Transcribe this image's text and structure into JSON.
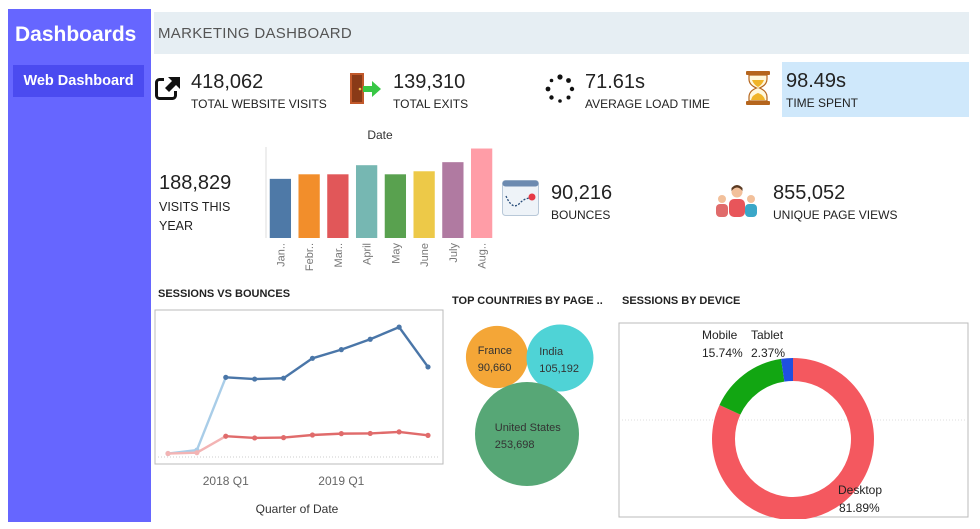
{
  "sidebar": {
    "brand": "Dashboards",
    "items": [
      {
        "label": "Web Dashboard"
      }
    ]
  },
  "header": {
    "title": "MARKETING DASHBOARD"
  },
  "kpis": {
    "visits": {
      "value": "418,062",
      "label": "TOTAL WEBSITE VISITS",
      "icon": "external-link-icon"
    },
    "exits": {
      "value": "139,310",
      "label": "TOTAL EXITS",
      "icon": "exit-door-icon"
    },
    "load": {
      "value": "71.61s",
      "label": "AVERAGE LOAD TIME",
      "icon": "loading-spinner-icon"
    },
    "time": {
      "value": "98.49s",
      "label": "TIME SPENT",
      "icon": "hourglass-icon"
    },
    "bounces": {
      "value": "90,216",
      "label": "BOUNCES",
      "icon": "bounce-chart-icon"
    },
    "unique": {
      "value": "855,052",
      "label": "UNIQUE PAGE VIEWS",
      "icon": "people-icon"
    }
  },
  "visits_year": {
    "value": "188,829",
    "label": "VISITS THIS YEAR"
  },
  "colors": {
    "sidebar": "#6666ff",
    "header": "#e6eef3",
    "highlight": "#cfe8fb",
    "desktop": "#f4585f",
    "mobile": "#12a612",
    "tablet": "#1f4fe0"
  },
  "sections": {
    "sessions_bounces": "SESSIONS VS BOUNCES",
    "top_countries": "TOP COUNTRIES BY PAGE ..",
    "sessions_device": "SESSIONS BY DEVICE"
  },
  "chart_data": [
    {
      "type": "bar",
      "title": "Date",
      "categories": [
        "Jan..",
        "Febr..",
        "Mar..",
        "April",
        "May",
        "June",
        "July",
        "Aug.."
      ],
      "values": [
        19500,
        21000,
        21000,
        24000,
        21000,
        22000,
        25000,
        29500
      ],
      "colors": [
        "#4e79a7",
        "#f28e2b",
        "#e15759",
        "#76b7b2",
        "#59a14f",
        "#edc948",
        "#b07aa1",
        "#ff9da7"
      ],
      "ylim": [
        0,
        30000
      ]
    },
    {
      "type": "line",
      "xlabel": "Quarter of Date",
      "x_tick_labels": [
        "2018 Q1",
        "2019 Q1"
      ],
      "series": [
        {
          "values": [
            0,
            2,
            44,
            43,
            43.5,
            55,
            60,
            66,
            73,
            50
          ],
          "color": "#4a76a8"
        },
        {
          "values": [
            0,
            0.5,
            10,
            9,
            9.2,
            10.7,
            11.5,
            11.6,
            12.5,
            10.5
          ],
          "color": "#e06b6b"
        }
      ],
      "ylim": [
        -2,
        80
      ]
    },
    {
      "type": "bubble",
      "labels": [
        "France",
        "India",
        "United States"
      ],
      "values": [
        90660,
        105192,
        253698
      ],
      "value_labels": [
        "90,660",
        "105,192",
        "253,698"
      ],
      "colors": [
        "#f4a637",
        "#4fd3d6",
        "#57a776"
      ]
    },
    {
      "type": "pie",
      "labels": [
        "Desktop",
        "Mobile",
        "Tablet"
      ],
      "values": [
        81.89,
        15.74,
        2.37
      ],
      "value_labels": [
        "81.89%",
        "15.74%",
        "2.37%"
      ],
      "colors": [
        "#f4585f",
        "#12a612",
        "#1f4fe0"
      ]
    }
  ]
}
